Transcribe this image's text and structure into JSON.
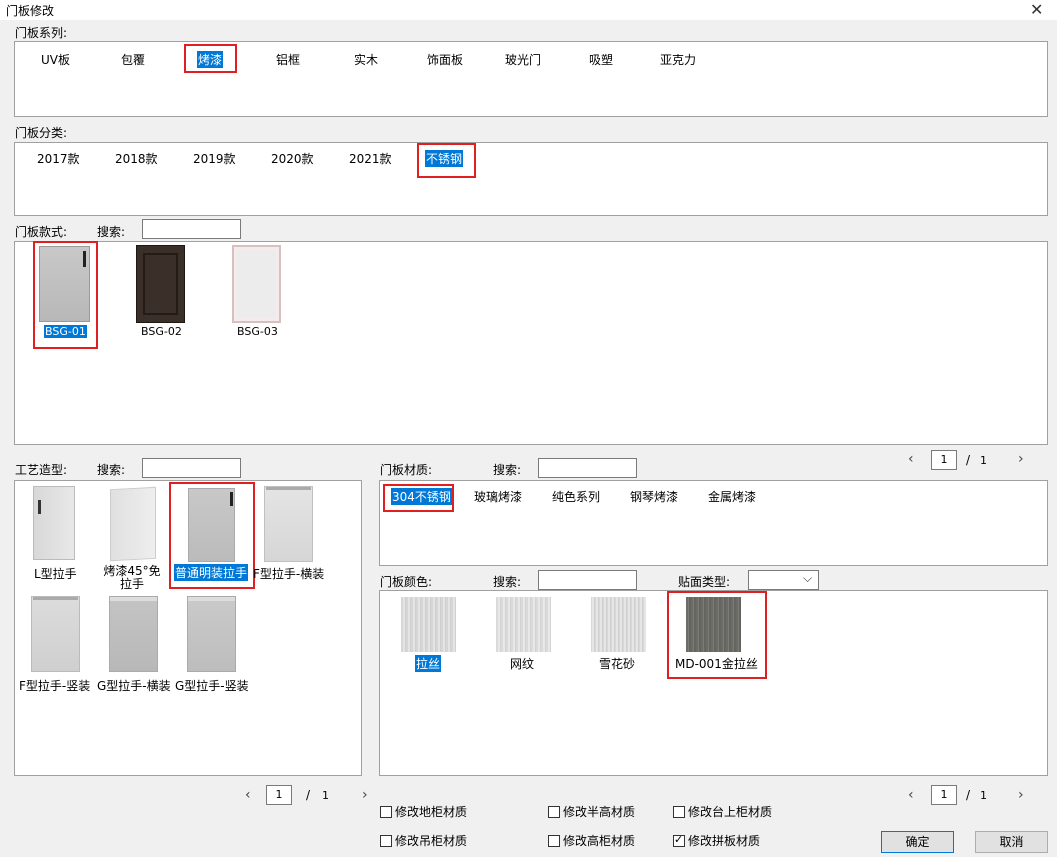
{
  "window": {
    "title": "门板修改",
    "close": "✕"
  },
  "series": {
    "label": "门板系列:",
    "items": [
      "UV板",
      "包覆",
      "烤漆",
      "铝框",
      "实木",
      "饰面板",
      "玻光门",
      "吸塑",
      "亚克力"
    ],
    "selected": 2
  },
  "category": {
    "label": "门板分类:",
    "items": [
      "2017款",
      "2018款",
      "2019款",
      "2020款",
      "2021款",
      "不锈钢"
    ],
    "selected": 5
  },
  "style": {
    "label": "门板款式:",
    "search_label": "搜索:",
    "items": [
      "BSG-01",
      "BSG-02",
      "BSG-03"
    ],
    "selected": 0,
    "pager": {
      "current": "1",
      "sep": "/",
      "total": "1"
    }
  },
  "craft": {
    "label": "工艺造型:",
    "search_label": "搜索:",
    "items": [
      "L型拉手",
      "烤漆45°免拉手",
      "普通明装拉手",
      "F型拉手-横装",
      "F型拉手-竖装",
      "G型拉手-横装",
      "G型拉手-竖装"
    ],
    "selected": 2,
    "pager": {
      "current": "1",
      "sep": "/",
      "total": "1"
    }
  },
  "material": {
    "label": "门板材质:",
    "search_label": "搜索:",
    "items": [
      "304不锈钢",
      "玻璃烤漆",
      "纯色系列",
      "钢琴烤漆",
      "金属烤漆"
    ],
    "selected": 0
  },
  "color": {
    "label": "门板颜色:",
    "search_label": "搜索:",
    "finish_label": "贴面类型:",
    "items": [
      "拉丝",
      "网纹",
      "雪花砂",
      "MD-001金拉丝"
    ],
    "selected": 0,
    "pager": {
      "current": "1",
      "sep": "/",
      "total": "1"
    }
  },
  "checkboxes": [
    {
      "label": "修改地柜材质",
      "checked": false
    },
    {
      "label": "修改半高材质",
      "checked": false
    },
    {
      "label": "修改台上柜材质",
      "checked": false
    },
    {
      "label": "修改吊柜材质",
      "checked": false
    },
    {
      "label": "修改高柜材质",
      "checked": false
    },
    {
      "label": "修改拼板材质",
      "checked": true
    }
  ],
  "buttons": {
    "ok": "确定",
    "cancel": "取消"
  },
  "icons": {
    "prev": "chevron-left-icon",
    "next": "chevron-right-icon",
    "dropdown": "chevron-down-icon"
  },
  "colors": {
    "selection": "#0078d7",
    "highlight_box": "#e02020"
  }
}
